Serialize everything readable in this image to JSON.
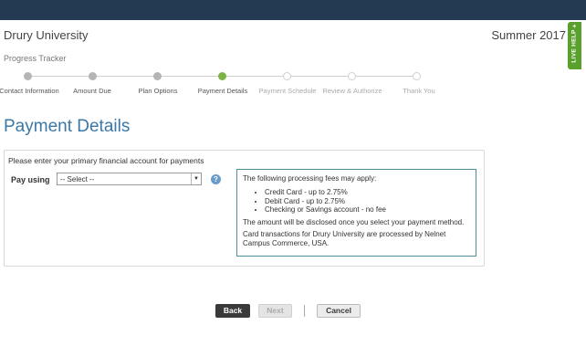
{
  "header": {
    "school": "Drury University",
    "term": "Summer 2017"
  },
  "live_help": {
    "label": "LIVE HELP",
    "plus": "+"
  },
  "tracker": {
    "label": "Progress Tracker",
    "steps": [
      {
        "label": "Contact Information",
        "state": "completed"
      },
      {
        "label": "Amount Due",
        "state": "completed"
      },
      {
        "label": "Plan Options",
        "state": "completed"
      },
      {
        "label": "Payment Details",
        "state": "current"
      },
      {
        "label": "Payment Schedule",
        "state": "future"
      },
      {
        "label": "Review & Authorize",
        "state": "future"
      },
      {
        "label": "Thank You",
        "state": "future"
      }
    ]
  },
  "page": {
    "title": "Payment Details",
    "instruction": "Please enter your primary financial account for payments",
    "pay_using_label": "Pay using",
    "select_value": "-- Select --",
    "help_glyph": "?"
  },
  "fees": {
    "intro": "The following processing fees may apply:",
    "items": [
      "Credit Card - up to 2.75%",
      "Debit Card - up to 2.75%",
      "Checking or Savings account - no fee"
    ],
    "note1": "The amount will be disclosed once you select your payment method.",
    "note2": "Card transactions for Drury University are processed by Nelnet Campus Commerce, USA."
  },
  "actions": {
    "back": "Back",
    "next": "Next",
    "cancel": "Cancel"
  },
  "colors": {
    "topbar": "#243a52",
    "accent": "#3a78a8",
    "current_step": "#7cb342",
    "help": "#5aa02c"
  }
}
